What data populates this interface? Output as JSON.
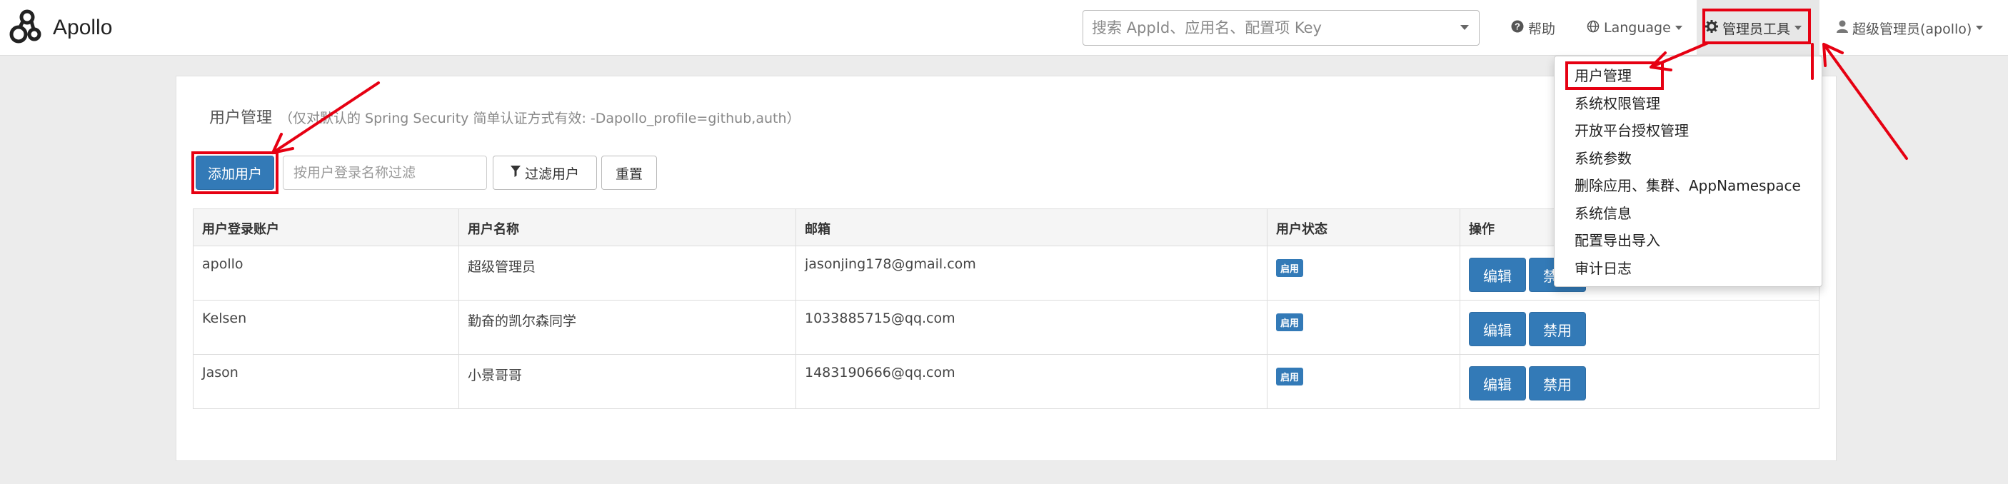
{
  "app": {
    "brand": "Apollo"
  },
  "navbar": {
    "search_placeholder": "搜索 AppId、应用名、配置项 Key",
    "help": "帮助",
    "language": "Language",
    "admin_tools": "管理员工具",
    "user": "超级管理员(apollo)"
  },
  "admin_menu": {
    "items": [
      "用户管理",
      "系统权限管理",
      "开放平台授权管理",
      "系统参数",
      "删除应用、集群、AppNamespace",
      "系统信息",
      "配置导出导入",
      "审计日志"
    ]
  },
  "panel": {
    "title": "用户管理",
    "note": "（仅对默认的 Spring Security 简单认证方式有效: -Dapollo_profile=github,auth）",
    "add_user": "添加用户",
    "filter_placeholder": "按用户登录名称过滤",
    "filter_button": "过滤用户",
    "reset_button": "重置"
  },
  "table": {
    "headers": [
      "用户登录账户",
      "用户名称",
      "邮箱",
      "用户状态",
      "操作"
    ],
    "rows": [
      {
        "login": "apollo",
        "name": "超级管理员",
        "email": "jasonjing178@gmail.com",
        "status": "启用",
        "edit": "编辑",
        "disable": "禁用"
      },
      {
        "login": "Kelsen",
        "name": "勤奋的凯尔森同学",
        "email": "1033885715@qq.com",
        "status": "启用",
        "edit": "编辑",
        "disable": "禁用"
      },
      {
        "login": "Jason",
        "name": "小景哥哥",
        "email": "1483190666@qq.com",
        "status": "启用",
        "edit": "编辑",
        "disable": "禁用"
      }
    ]
  },
  "colors": {
    "primary": "#337ab7",
    "highlight": "#e60012",
    "navbar_bg": "#ffffff",
    "page_bg": "#ececec"
  }
}
